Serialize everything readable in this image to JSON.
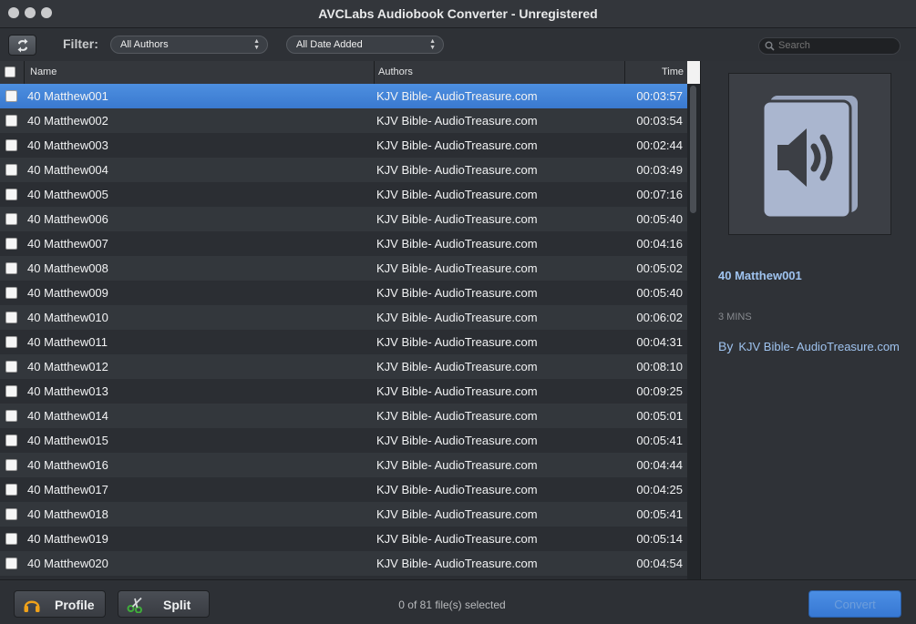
{
  "window": {
    "title": "AVCLabs Audiobook Converter - Unregistered"
  },
  "toolbar": {
    "filter_label": "Filter:",
    "authors_select": "All Authors",
    "date_select": "All Date Added",
    "search_placeholder": "Search"
  },
  "table": {
    "columns": {
      "name": "Name",
      "authors": "Authors",
      "time": "Time"
    },
    "rows": [
      {
        "name": "40 Matthew001",
        "author": "KJV Bible- AudioTreasure.com",
        "time": "00:03:57",
        "selected": true
      },
      {
        "name": "40 Matthew002",
        "author": "KJV Bible- AudioTreasure.com",
        "time": "00:03:54"
      },
      {
        "name": "40 Matthew003",
        "author": "KJV Bible- AudioTreasure.com",
        "time": "00:02:44"
      },
      {
        "name": "40 Matthew004",
        "author": "KJV Bible- AudioTreasure.com",
        "time": "00:03:49"
      },
      {
        "name": "40 Matthew005",
        "author": "KJV Bible- AudioTreasure.com",
        "time": "00:07:16"
      },
      {
        "name": "40 Matthew006",
        "author": "KJV Bible- AudioTreasure.com",
        "time": "00:05:40"
      },
      {
        "name": "40 Matthew007",
        "author": "KJV Bible- AudioTreasure.com",
        "time": "00:04:16"
      },
      {
        "name": "40 Matthew008",
        "author": "KJV Bible- AudioTreasure.com",
        "time": "00:05:02"
      },
      {
        "name": "40 Matthew009",
        "author": "KJV Bible- AudioTreasure.com",
        "time": "00:05:40"
      },
      {
        "name": "40 Matthew010",
        "author": "KJV Bible- AudioTreasure.com",
        "time": "00:06:02"
      },
      {
        "name": "40 Matthew011",
        "author": "KJV Bible- AudioTreasure.com",
        "time": "00:04:31"
      },
      {
        "name": "40 Matthew012",
        "author": "KJV Bible- AudioTreasure.com",
        "time": "00:08:10"
      },
      {
        "name": "40 Matthew013",
        "author": "KJV Bible- AudioTreasure.com",
        "time": "00:09:25"
      },
      {
        "name": "40 Matthew014",
        "author": "KJV Bible- AudioTreasure.com",
        "time": "00:05:01"
      },
      {
        "name": "40 Matthew015",
        "author": "KJV Bible- AudioTreasure.com",
        "time": "00:05:41"
      },
      {
        "name": "40 Matthew016",
        "author": "KJV Bible- AudioTreasure.com",
        "time": "00:04:44"
      },
      {
        "name": "40 Matthew017",
        "author": "KJV Bible- AudioTreasure.com",
        "time": "00:04:25"
      },
      {
        "name": "40 Matthew018",
        "author": "KJV Bible- AudioTreasure.com",
        "time": "00:05:41"
      },
      {
        "name": "40 Matthew019",
        "author": "KJV Bible- AudioTreasure.com",
        "time": "00:05:14"
      },
      {
        "name": "40 Matthew020",
        "author": "KJV Bible- AudioTreasure.com",
        "time": "00:04:54"
      }
    ]
  },
  "details": {
    "title": "40 Matthew001",
    "duration": "3 MINS",
    "by_label": "By",
    "author": "KJV Bible- AudioTreasure.com",
    "cover_icon": "audiobook-speaker-icon"
  },
  "bottom": {
    "profile_label": "Profile",
    "split_label": "Split",
    "status": "0 of 81 file(s) selected",
    "convert_label": "Convert"
  },
  "colors": {
    "accent": "#3f7fd6",
    "detail_text": "#9fc3ef",
    "profile_icon": "#f0a21a",
    "split_icon": "#3fae3a"
  }
}
